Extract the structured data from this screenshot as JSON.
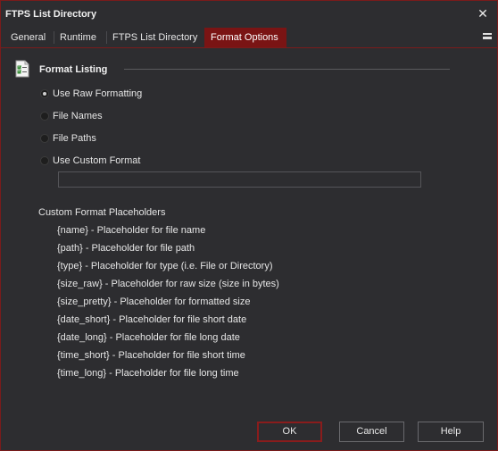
{
  "window": {
    "title": "FTPS List Directory",
    "close_glyph": "✕"
  },
  "tabs": [
    {
      "label": "General",
      "active": false
    },
    {
      "label": "Runtime",
      "active": false
    },
    {
      "label": "FTPS List Directory",
      "active": false
    },
    {
      "label": "Format Options",
      "active": true
    }
  ],
  "tab_menu_icon": "hamburger-icon",
  "section": {
    "title": "Format Listing",
    "icon": "checklist-document-icon"
  },
  "radio_options": [
    {
      "label": "Use Raw Formatting",
      "checked": true
    },
    {
      "label": "File Names",
      "checked": false
    },
    {
      "label": "File Paths",
      "checked": false
    },
    {
      "label": "Use Custom Format",
      "checked": false
    }
  ],
  "custom_format": {
    "value": ""
  },
  "placeholders": {
    "heading": "Custom Format Placeholders",
    "items": [
      "{name} - Placeholder for file name",
      "{path} - Placeholder for file path",
      "{type} - Placeholder for type (i.e. File or Directory)",
      "{size_raw} - Placeholder for raw size (size in bytes)",
      "{size_pretty} - Placeholder for formatted size",
      "{date_short} - Placeholder for file short date",
      "{date_long} - Placeholder for file long date",
      "{time_short} - Placeholder for file short time",
      "{time_long} - Placeholder for file long time"
    ]
  },
  "buttons": {
    "ok": "OK",
    "cancel": "Cancel",
    "help": "Help"
  },
  "colors": {
    "background": "#2d2d30",
    "accent": "#7a1414",
    "border_accent": "#8a1c1c",
    "text": "#e6e6e6"
  }
}
